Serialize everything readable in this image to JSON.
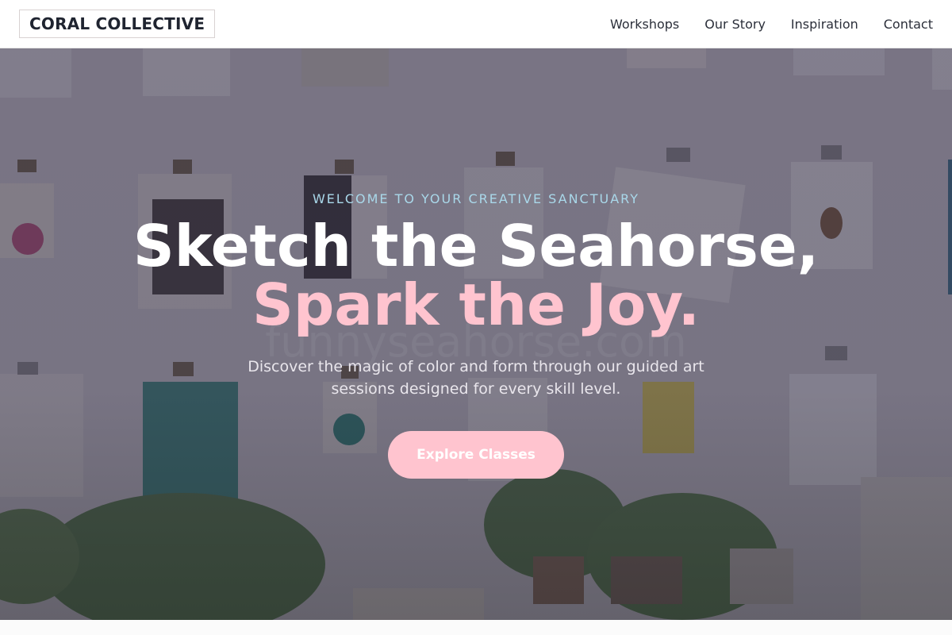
{
  "header": {
    "logo": "CORAL COLLECTIVE",
    "nav": [
      "Workshops",
      "Our Story",
      "Inspiration",
      "Contact"
    ]
  },
  "hero": {
    "eyebrow": "WELCOME TO YOUR CREATIVE SANCTUARY",
    "title_line1": "Sketch the Seahorse,",
    "title_line2": "Spark the Joy.",
    "subtitle": "Discover the magic of color and form through our guided art sessions designed for every skill level.",
    "cta_label": "Explore Classes",
    "watermark": "funnyseahorse.com",
    "background_icon": "clipboard-wall-photo"
  },
  "colors": {
    "accent_pink": "#ffc4cf",
    "eyebrow_blue": "#a9d8ea",
    "header_text": "#1f2430"
  }
}
